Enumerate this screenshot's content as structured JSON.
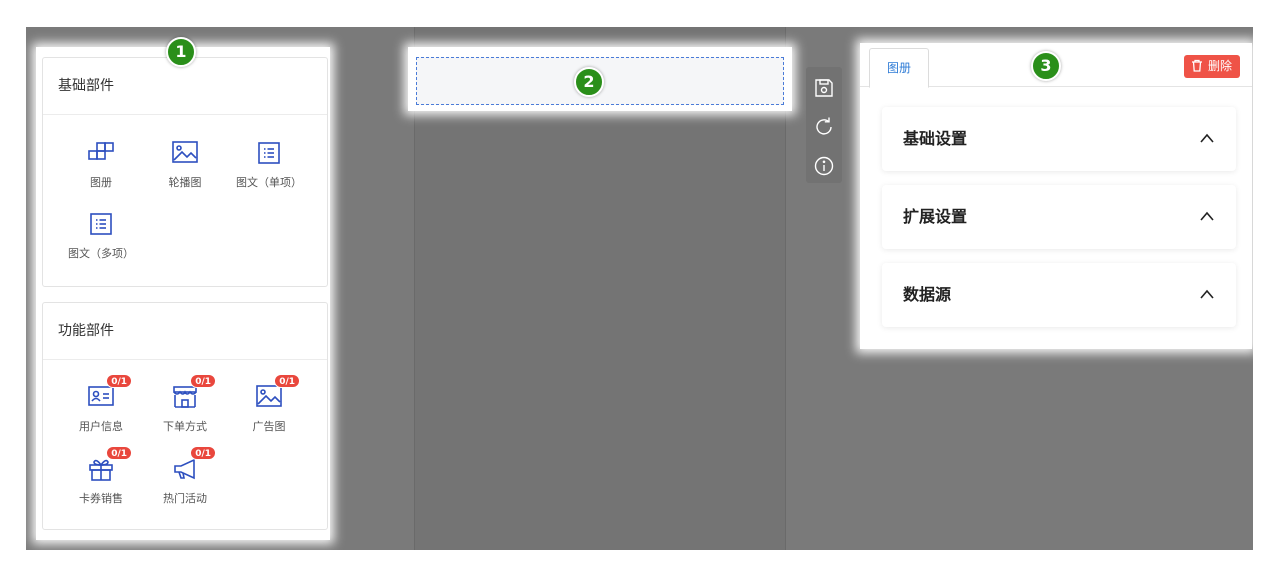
{
  "markers": [
    "1",
    "2",
    "3"
  ],
  "basic_parts": {
    "title": "基础部件",
    "items": [
      {
        "label": "图册",
        "icon": "album-icon"
      },
      {
        "label": "轮播图",
        "icon": "image-icon"
      },
      {
        "label": "图文（单项）",
        "icon": "list-icon"
      },
      {
        "label": "图文（多项）",
        "icon": "list-icon"
      }
    ]
  },
  "function_parts": {
    "title": "功能部件",
    "items": [
      {
        "label": "用户信息",
        "icon": "user-card-icon",
        "badge": "0/1"
      },
      {
        "label": "下单方式",
        "icon": "store-icon",
        "badge": "0/1"
      },
      {
        "label": "广告图",
        "icon": "image-icon",
        "badge": "0/1"
      },
      {
        "label": "卡券销售",
        "icon": "gift-icon",
        "badge": "0/1"
      },
      {
        "label": "热门活动",
        "icon": "megaphone-icon",
        "badge": "0/1"
      }
    ]
  },
  "toolbar": {
    "icons": [
      "save-icon",
      "refresh-icon",
      "info-icon"
    ]
  },
  "right_panel": {
    "tab": "图册",
    "delete_label": "删除",
    "sections": [
      "基础设置",
      "扩展设置",
      "数据源"
    ]
  },
  "colors": {
    "accent": "#2f7cd6",
    "icon_blue": "#2d4fbf",
    "badge_red": "#e9473d",
    "delete_red": "#ef5347",
    "marker_green": "#2a8f1a"
  }
}
